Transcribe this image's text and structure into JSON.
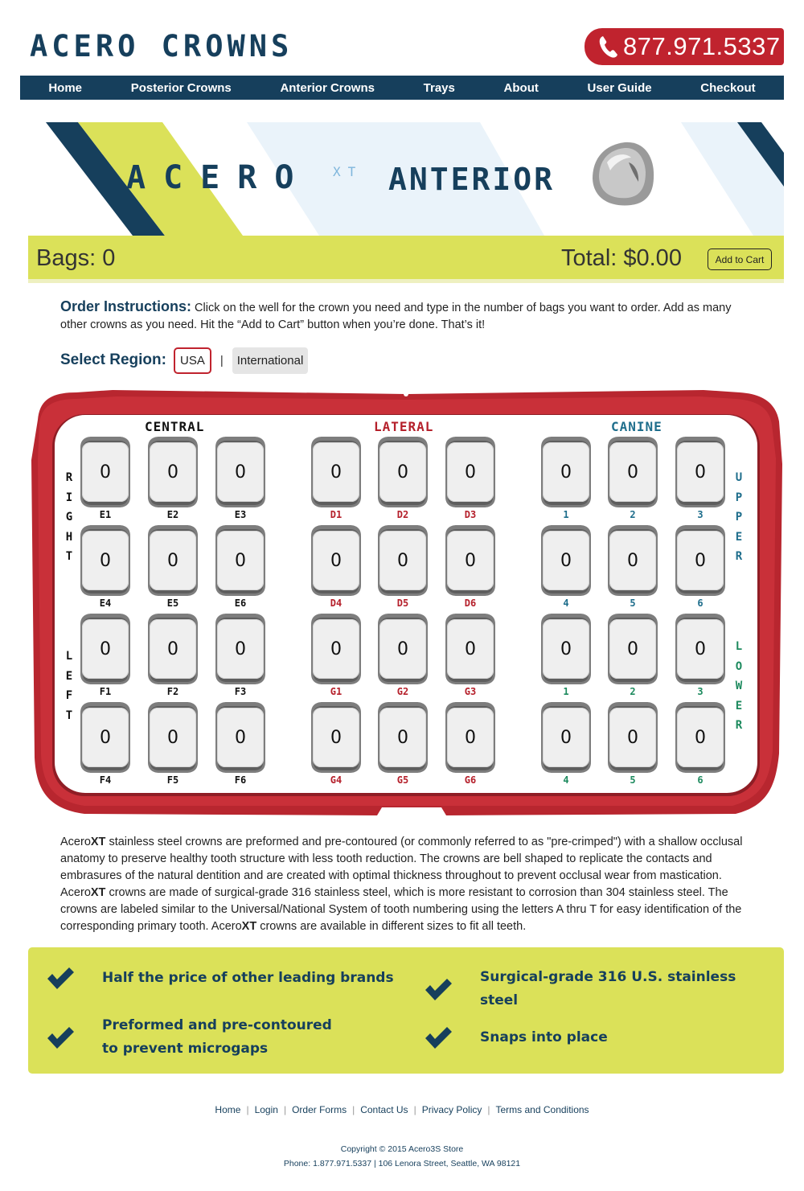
{
  "header": {
    "logo": "ACERO CROWNS",
    "phone": "877.971.5337",
    "phone_icon": "phone-icon",
    "brand_color": "#163f5c",
    "accent_color": "#c0232e"
  },
  "nav": {
    "items": [
      "Home",
      "Posterior Crowns",
      "Anterior Crowns",
      "Trays",
      "About",
      "User Guide",
      "Checkout"
    ]
  },
  "banner": {
    "brand": "ACERO",
    "superscript": "XT",
    "product": "ANTERIOR"
  },
  "cart": {
    "bags_label": "Bags: 0",
    "total_label": "Total: $0.00",
    "add_to_cart": "Add to Cart"
  },
  "instructions": {
    "title": "Order Instructions:",
    "text": " Click on the well for the crown you need and type in the number of bags you want to order. Add as many other crowns as you need. Hit the “Add to Cart” button when you’re done. That’s it!"
  },
  "region": {
    "label": "Select Region:",
    "options": [
      "USA",
      "International"
    ],
    "separator": "|",
    "selected": "USA"
  },
  "tray": {
    "side_labels": {
      "right": "RIGHT",
      "left": "LEFT",
      "upper": "UPPER",
      "lower": "LOWER"
    },
    "columns": [
      {
        "title": "CENTRAL",
        "color": "#111111",
        "labels": [
          [
            "E1",
            "E2",
            "E3"
          ],
          [
            "E4",
            "E5",
            "E6"
          ],
          [
            "F1",
            "F2",
            "F3"
          ],
          [
            "F4",
            "F5",
            "F6"
          ]
        ]
      },
      {
        "title": "LATERAL",
        "color": "#b5202b",
        "labels": [
          [
            "D1",
            "D2",
            "D3"
          ],
          [
            "D4",
            "D5",
            "D6"
          ],
          [
            "G1",
            "G2",
            "G3"
          ],
          [
            "G4",
            "G5",
            "G6"
          ]
        ]
      },
      {
        "title": "CANINE",
        "color": "#1f6e8c",
        "labels": [
          [
            "1",
            "2",
            "3"
          ],
          [
            "4",
            "5",
            "6"
          ],
          [
            "1",
            "2",
            "3"
          ],
          [
            "4",
            "5",
            "6"
          ]
        ]
      }
    ],
    "well_value": "0"
  },
  "description": {
    "parts": [
      "Acero",
      "XT",
      " stainless steel crowns are preformed and pre-contoured (or commonly referred to as \"pre-crimped\") with a shallow occlusal anatomy to preserve healthy tooth structure with less tooth reduction. The crowns are bell shaped to replicate the contacts and embrasures of the natural dentition and are created with optimal thickness throughout to prevent occlusal wear from mastication. Acero",
      "XT",
      " crowns are made of surgical-grade 316 stainless steel, which is more resistant to corrosion than 304 stainless steel. The crowns are labeled similar to the Universal/National System of tooth numbering using the letters A thru T for easy identification of the corresponding primary tooth. Acero",
      "XT",
      " crowns are available in different sizes to fit all teeth."
    ]
  },
  "features": {
    "icon": "checkmark-icon",
    "items": [
      "Half the price of other leading brands",
      "Surgical-grade 316 U.S. stainless steel",
      "Preformed and pre-contoured to prevent microgaps",
      "Snaps into place"
    ]
  },
  "footer": {
    "links": [
      "Home",
      "Login",
      "Order Forms",
      "Contact Us",
      "Privacy Policy",
      "Terms and Conditions"
    ],
    "copyright": "Copyright © 2015 Acero3S Store",
    "address": "Phone: 1.877.971.5337 | 106 Lenora Street, Seattle, WA 98121"
  }
}
